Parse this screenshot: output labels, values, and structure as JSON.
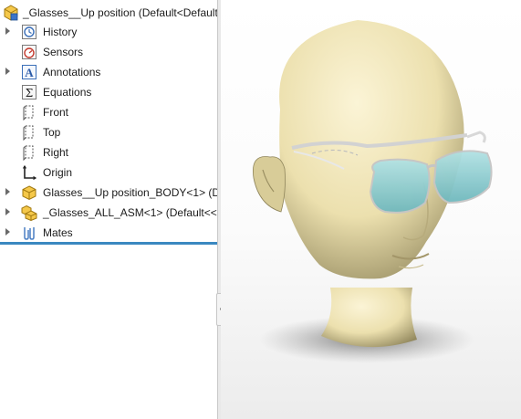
{
  "tree": {
    "root": {
      "label": "_Glasses__Up position  (Default<Default_"
    },
    "items": [
      {
        "label": "History",
        "icon": "history-icon",
        "expandable": true
      },
      {
        "label": "Sensors",
        "icon": "sensors-icon",
        "expandable": false
      },
      {
        "label": "Annotations",
        "icon": "annotations-icon",
        "expandable": true
      },
      {
        "label": "Equations",
        "icon": "equations-icon",
        "expandable": false
      },
      {
        "label": "Front",
        "icon": "plane-icon",
        "expandable": false
      },
      {
        "label": "Top",
        "icon": "plane-icon",
        "expandable": false
      },
      {
        "label": "Right",
        "icon": "plane-icon",
        "expandable": false
      },
      {
        "label": "Origin",
        "icon": "origin-icon",
        "expandable": false
      },
      {
        "label": "Glasses__Up position_BODY<1> (Def",
        "icon": "part-icon",
        "expandable": true
      },
      {
        "label": "_Glasses_ALL_ASM<1> (Default<<D",
        "icon": "assembly-icon",
        "expandable": true
      },
      {
        "label": "Mates",
        "icon": "mates-icon",
        "expandable": true
      }
    ]
  },
  "colors": {
    "accent": "#3a88c0",
    "skin": "#efe3b5",
    "lens": "#8fd0d4",
    "frame": "#dcdcdc"
  }
}
